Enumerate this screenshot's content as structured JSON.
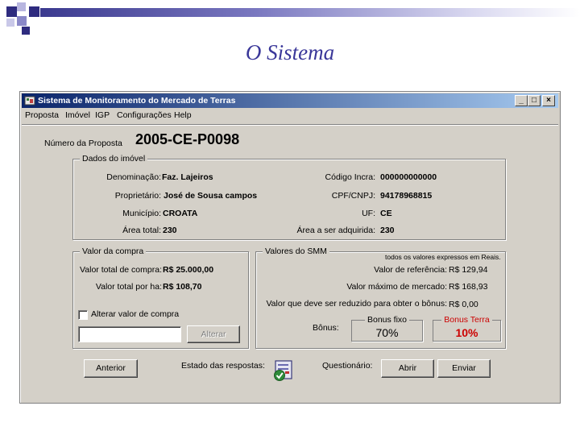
{
  "slide": {
    "title": "O Sistema"
  },
  "window": {
    "title": "Sistema de Monitoramento do Mercado de Terras",
    "minimize": "_",
    "maximize": "□",
    "close": "×"
  },
  "menu": [
    "Proposta",
    "Imóvel",
    "IGP",
    "Configurações",
    "Help"
  ],
  "proposal": {
    "label": "Número da Proposta",
    "value": "2005-CE-P0098"
  },
  "property": {
    "legend": "Dados do imóvel",
    "denomination_label": "Denominação:",
    "denomination": "Faz. Lajeiros",
    "code_label": "Código Incra:",
    "code": "000000000000",
    "owner_label": "Proprietário:",
    "owner": "José de Sousa campos",
    "cpf_label": "CPF/CNPJ:",
    "cpf": "94178968815",
    "city_label": "Município:",
    "city": "CROATA",
    "uf_label": "UF:",
    "uf": "CE",
    "total_area_label": "Área total:",
    "total_area": "230",
    "acquired_area_label": "Área a ser adquirida:",
    "acquired_area": "230"
  },
  "purchase": {
    "legend": "Valor da compra",
    "total_label": "Valor total de compra:",
    "total": "R$ 25.000,00",
    "per_ha_label": "Valor total por ha:",
    "per_ha": "R$ 108,70",
    "change_checkbox_label": "Alterar valor de compra",
    "input_value": "",
    "change_button": "Alterar"
  },
  "smm": {
    "legend": "Valores do SMM",
    "note": "todos os valores expressos em Reais.",
    "reference_label": "Valor de referência:",
    "reference": "R$ 129,94",
    "max_label": "Valor máximo de mercado:",
    "max": "R$ 168,93",
    "reduce_label": "Valor que deve ser reduzido para obter o bônus:",
    "reduce": "R$ 0,00",
    "bonus_label": "Bônus:",
    "fixed_title": "Bonus fixo",
    "fixed_value": "70%",
    "terra_title": "Bonus Terra",
    "terra_value": "10%"
  },
  "footer": {
    "previous_button": "Anterior",
    "state_label": "Estado das respostas:",
    "questionnaire_label": "Questionário:",
    "open_button": "Abrir",
    "send_button": "Enviar"
  },
  "colors": {
    "slide_title": "#3a3799",
    "bonus_terra": "#cc0000",
    "titlebar": "#0a246a"
  }
}
